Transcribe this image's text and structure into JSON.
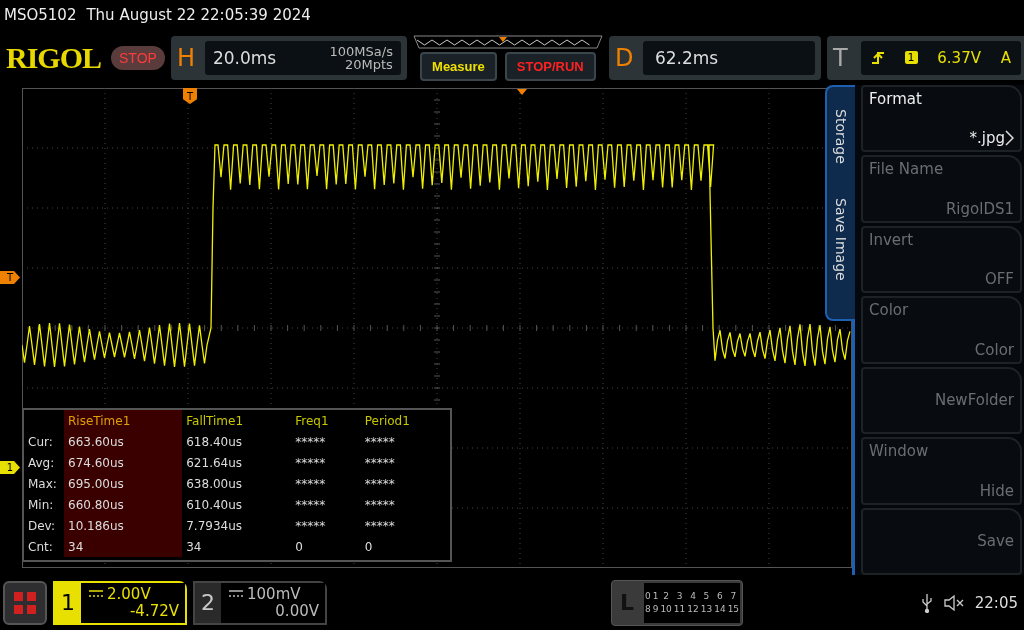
{
  "header": {
    "model": "MSO5102",
    "datetime": "Thu August 22 22:05:39 2024"
  },
  "toolbar": {
    "logo": "RIGOL",
    "run_state": "STOP",
    "horizontal": {
      "label": "H",
      "timebase": "20.0ms",
      "sample_rate": "100MSa/s",
      "memory_depth": "20Mpts"
    },
    "buttons": [
      {
        "label": "Measure",
        "kind": "measure"
      },
      {
        "label": "STOP/RUN",
        "kind": "run"
      }
    ],
    "delay": {
      "label": "D",
      "value": "62.2ms"
    },
    "trigger": {
      "label": "T",
      "source": "1",
      "level": "6.37V",
      "mode": "A"
    }
  },
  "plot": {
    "trigger_position_marker": "T",
    "trigger_level_marker": "T",
    "channel_marker": "1"
  },
  "measurements": {
    "columns": [
      {
        "label": "RiseTime1",
        "selected": true
      },
      {
        "label": "FallTime1",
        "selected": false
      },
      {
        "label": "Freq1",
        "selected": false
      },
      {
        "label": "Period1",
        "selected": false
      }
    ],
    "rows": [
      {
        "label": "Cur:",
        "values": [
          "663.60us",
          "618.40us",
          "*****",
          "*****"
        ]
      },
      {
        "label": "Avg:",
        "values": [
          "674.60us",
          "621.64us",
          "*****",
          "*****"
        ]
      },
      {
        "label": "Max:",
        "values": [
          "695.00us",
          "638.00us",
          "*****",
          "*****"
        ]
      },
      {
        "label": "Min:",
        "values": [
          "660.80us",
          "610.40us",
          "*****",
          "*****"
        ]
      },
      {
        "label": "Dev:",
        "values": [
          "10.186us",
          "7.7934us",
          "*****",
          "*****"
        ]
      },
      {
        "label": "Cnt:",
        "values": [
          "34",
          "34",
          "0",
          "0"
        ]
      }
    ]
  },
  "menu": {
    "tabs": [
      "Storage",
      "Save Image"
    ],
    "items": [
      {
        "label": "Format",
        "value": "*.jpg",
        "submenu": true,
        "disabled": false
      },
      {
        "label": "File Name",
        "value": "RigolDS1",
        "submenu": false,
        "disabled": true
      },
      {
        "label": "Invert",
        "value": "OFF",
        "submenu": false,
        "disabled": true
      },
      {
        "label": "Color",
        "value": "Color",
        "submenu": false,
        "disabled": true
      },
      {
        "value": "NewFolder",
        "submenu": false,
        "disabled": true
      },
      {
        "label": "Window",
        "value": "Hide",
        "submenu": false,
        "disabled": true
      },
      {
        "value": "Save",
        "submenu": false,
        "disabled": true
      }
    ]
  },
  "channels": [
    {
      "number": "1",
      "scale": "2.00V",
      "offset": "-4.72V",
      "active": true
    },
    {
      "number": "2",
      "scale": "100mV",
      "offset": "0.00V",
      "active": false
    }
  ],
  "logic": {
    "label": "L",
    "rows": [
      [
        "0",
        "1",
        "2",
        "3",
        "4",
        "5",
        "6",
        "7"
      ],
      [
        "8",
        "9",
        "10",
        "11",
        "12",
        "13",
        "14",
        "15"
      ]
    ]
  },
  "status": {
    "time": "22:05"
  }
}
